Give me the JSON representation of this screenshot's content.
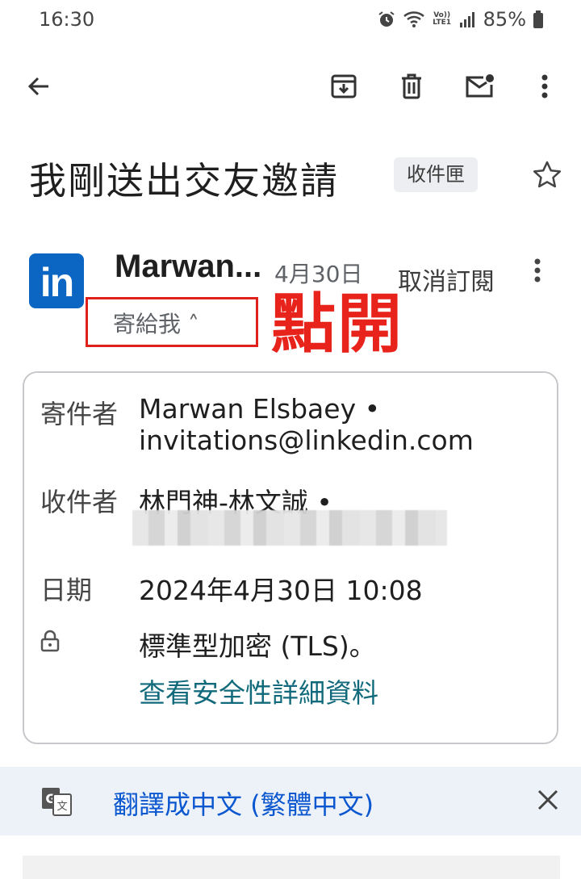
{
  "status": {
    "time": "16:30",
    "network": "Vo)) LTE1",
    "battery": "85%"
  },
  "toolbar": {
    "back": "back-arrow-icon",
    "archive": "archive-icon",
    "delete": "trash-icon",
    "mark_unread": "mark-unread-icon",
    "more": "more-vert-icon"
  },
  "email": {
    "subject": "我剛送出交友邀請",
    "label_chip": "收件匣",
    "sender_short": "Marwan...",
    "date_short": "4月30日",
    "unsubscribe": "取消訂閱",
    "to_me": "寄給我 ˄",
    "annotation": "點開",
    "avatar_text": "in"
  },
  "details": {
    "from_label": "寄件者",
    "from_name": "Marwan Elsbaey •",
    "from_email": "invitations@linkedin.com",
    "to_label": "收件者",
    "to_name": "林門神-林文誠 •",
    "date_label": "日期",
    "date_value": "2024年4月30日 10:08",
    "security_value": "標準型加密 (TLS)。",
    "security_link": "查看安全性詳細資料"
  },
  "translate": {
    "text": "翻譯成中文 (繁體中文)"
  },
  "colors": {
    "linkedin_blue": "#0a66c2",
    "annotation_red": "#e8231b",
    "link_teal": "#116a7b",
    "translate_blue": "#0b57d0",
    "translate_bg": "#edf2f8"
  }
}
